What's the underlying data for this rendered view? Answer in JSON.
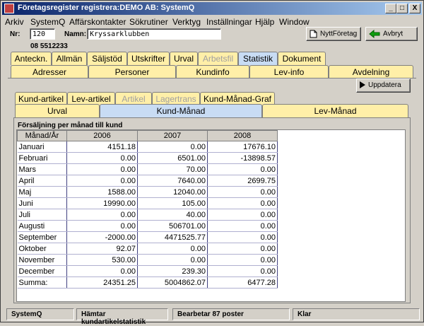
{
  "window": {
    "title": "Företagsregister registrera:DEMO AB: SystemQ",
    "minimize": "_",
    "maximize": "□",
    "close": "X"
  },
  "menu": [
    "Arkiv",
    "SystemQ",
    "Affärskontakter",
    "Sökrutiner",
    "Verktyg",
    "Inställningar",
    "Hjälp",
    "Window"
  ],
  "header": {
    "nr_label": "Nr:",
    "nr_value": "120",
    "namn_label": "Namn:",
    "namn_value": "Kryssarklubben",
    "phone": "08 5512233",
    "new_company_label": "NyttFöretag",
    "cancel_label": "Avbryt"
  },
  "tabs_row1": [
    {
      "label": "Anteckn.",
      "state": "normal"
    },
    {
      "label": "Allmän",
      "state": "normal"
    },
    {
      "label": "Säljstöd",
      "state": "normal"
    },
    {
      "label": "Utskrifter",
      "state": "normal"
    },
    {
      "label": "Urval",
      "state": "normal"
    },
    {
      "label": "Arbetsfil",
      "state": "disabled"
    },
    {
      "label": "Statistik",
      "state": "active"
    },
    {
      "label": "Dokument",
      "state": "normal"
    }
  ],
  "tabs_row2": [
    "Adresser",
    "Personer",
    "Kundinfo",
    "Lev-info",
    "Avdelning"
  ],
  "update_label": "Uppdatera",
  "subtabs_row1": [
    {
      "label": "Kund-artikel",
      "state": "normal"
    },
    {
      "label": "Lev-artikel",
      "state": "normal"
    },
    {
      "label": "Artikel",
      "state": "disabled"
    },
    {
      "label": "Lagertrans",
      "state": "disabled"
    },
    {
      "label": "Kund-Månad-Graf",
      "state": "normal"
    }
  ],
  "subtabs_row2": [
    {
      "label": "Urval",
      "state": "normal"
    },
    {
      "label": "Kund-Månad",
      "state": "active"
    },
    {
      "label": "Lev-Månad",
      "state": "normal"
    }
  ],
  "table": {
    "caption": "Försäljning per månad till kund",
    "headers": [
      "Månad/År",
      "2006",
      "2007",
      "2008"
    ],
    "rows": [
      [
        "Januari",
        "4151.18",
        "0.00",
        "17676.10"
      ],
      [
        "Februari",
        "0.00",
        "6501.00",
        "-13898.57"
      ],
      [
        "Mars",
        "0.00",
        "70.00",
        "0.00"
      ],
      [
        "April",
        "0.00",
        "7640.00",
        "2699.75"
      ],
      [
        "Maj",
        "1588.00",
        "12040.00",
        "0.00"
      ],
      [
        "Juni",
        "19990.00",
        "105.00",
        "0.00"
      ],
      [
        "Juli",
        "0.00",
        "40.00",
        "0.00"
      ],
      [
        "Augusti",
        "0.00",
        "506701.00",
        "0.00"
      ],
      [
        "September",
        "-2000.00",
        "4471525.77",
        "0.00"
      ],
      [
        "Oktober",
        "92.07",
        "0.00",
        "0.00"
      ],
      [
        "November",
        "530.00",
        "0.00",
        "0.00"
      ],
      [
        "December",
        "0.00",
        "239.30",
        "0.00"
      ],
      [
        "Summa:",
        "24351.25",
        "5004862.07",
        "6477.28"
      ]
    ]
  },
  "statusbar": [
    "SystemQ",
    "Hämtar kundartikelstatistik",
    "Bearbetar 87 poster",
    "Klar"
  ]
}
